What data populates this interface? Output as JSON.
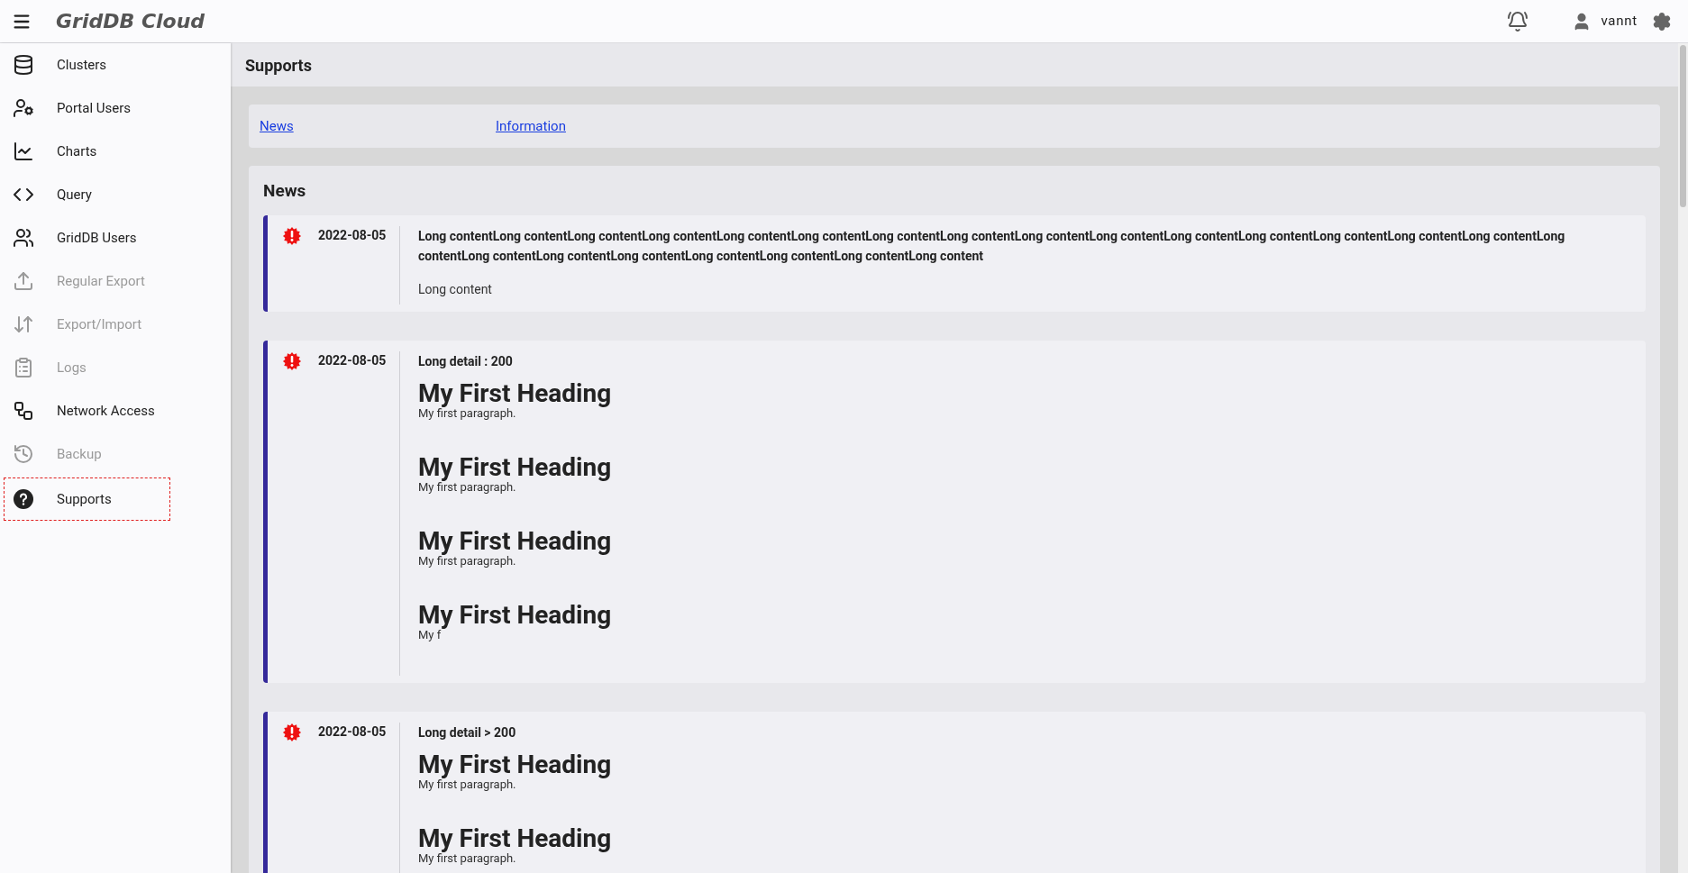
{
  "app": {
    "title": "GridDB Cloud"
  },
  "header": {
    "user": "vannt"
  },
  "sidebar": {
    "items": [
      {
        "label": "Clusters",
        "disabled": false,
        "selected": false
      },
      {
        "label": "Portal Users",
        "disabled": false,
        "selected": false
      },
      {
        "label": "Charts",
        "disabled": false,
        "selected": false
      },
      {
        "label": "Query",
        "disabled": false,
        "selected": false
      },
      {
        "label": "GridDB Users",
        "disabled": false,
        "selected": false
      },
      {
        "label": "Regular Export",
        "disabled": true,
        "selected": false
      },
      {
        "label": "Export/Import",
        "disabled": true,
        "selected": false
      },
      {
        "label": "Logs",
        "disabled": true,
        "selected": false
      },
      {
        "label": "Network Access",
        "disabled": false,
        "selected": false
      },
      {
        "label": "Backup",
        "disabled": true,
        "selected": false
      },
      {
        "label": "Supports",
        "disabled": false,
        "selected": true
      }
    ]
  },
  "page": {
    "title": "Supports"
  },
  "links": [
    "News",
    "Information"
  ],
  "news": {
    "title": "News",
    "items": [
      {
        "date": "2022-08-05",
        "title": "Long contentLong contentLong contentLong contentLong contentLong contentLong contentLong contentLong contentLong contentLong contentLong contentLong contentLong contentLong contentLong contentLong contentLong contentLong contentLong contentLong contentLong contentLong content",
        "body": [
          {
            "kind": "text",
            "text": "Long content"
          }
        ]
      },
      {
        "date": "2022-08-05",
        "title": "Long detail : 200",
        "body": [
          {
            "kind": "section",
            "heading": "My First Heading",
            "paragraph": "My first paragraph."
          },
          {
            "kind": "section",
            "heading": "My First Heading",
            "paragraph": "My first paragraph."
          },
          {
            "kind": "section",
            "heading": "My First Heading",
            "paragraph": "My first paragraph."
          },
          {
            "kind": "section",
            "heading": "My First Heading",
            "paragraph": "My f"
          }
        ]
      },
      {
        "date": "2022-08-05",
        "title": "Long detail > 200",
        "body": [
          {
            "kind": "section",
            "heading": "My First Heading",
            "paragraph": "My first paragraph."
          },
          {
            "kind": "section",
            "heading": "My First Heading",
            "paragraph": "My first paragraph."
          }
        ]
      }
    ]
  }
}
